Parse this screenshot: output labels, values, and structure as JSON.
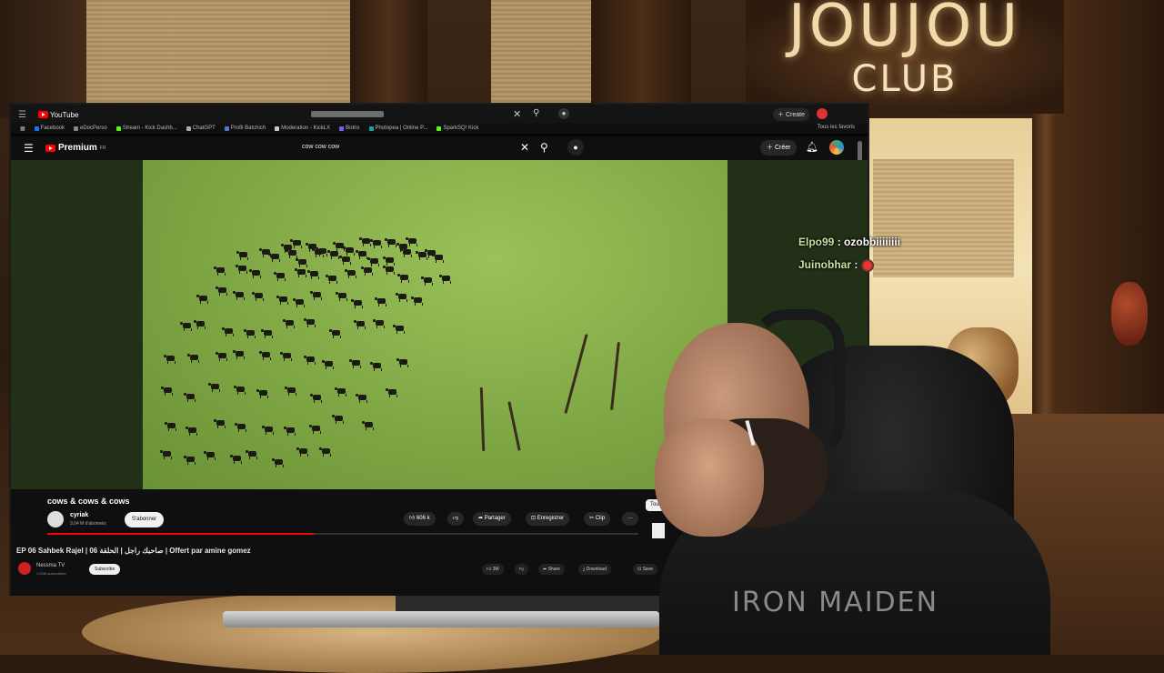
{
  "sign": {
    "title": "JOUJOU",
    "subtitle": "CLUB"
  },
  "browser": {
    "logo_text": "YouTube",
    "create_label": "Create",
    "bookmarks": [
      {
        "label": "Facebook",
        "color": "#1877f2"
      },
      {
        "label": "eDocPerso",
        "color": "#888888"
      },
      {
        "label": "Stream - Kick Dashb...",
        "color": "#53fc18"
      },
      {
        "label": "ChatGPT",
        "color": "#aaaaaa"
      },
      {
        "label": "Profil Batchich",
        "color": "#4a7bd1"
      },
      {
        "label": "Moderation - KickLX",
        "color": "#cccccc"
      },
      {
        "label": "Botrix",
        "color": "#7a5af8"
      },
      {
        "label": "Photopea | Online P...",
        "color": "#18a497"
      },
      {
        "label": "SparkSQ! Kick",
        "color": "#53fc18"
      }
    ],
    "bookmarks_right": "Tous les favoris"
  },
  "youtube": {
    "logo_text": "Premium",
    "logo_sup": "FR",
    "search_value": "cow cow cow",
    "create_label": "Créer"
  },
  "video": {
    "title": "cows & cows & cows",
    "channel": "cyriak",
    "subscribers": "3,04 M d'abonnés",
    "subscribe_label": "S'abonner",
    "likes": "606 k",
    "share_label": "Partager",
    "save_label": "Enregistrer",
    "clip_label": "Clip",
    "more_label": "···",
    "filter_label": "Tout",
    "progress": 0.45
  },
  "overlay_video": {
    "title": "EP 06 Sahbek Rajel | صاحبك راجل | الحلقة 06 | Offert par amine gomez",
    "channel": "Nessma TV",
    "subscribers": "1,93M subscribers",
    "subscribe_label": "Subscribe",
    "likes": "3M",
    "share_label": "Share",
    "download_label": "Download",
    "save_label": "Save"
  },
  "chat": [
    {
      "user": "Elpo99",
      "message": "ozobbiiiiiiii"
    },
    {
      "user": "Juinobhar",
      "message": ""
    }
  ],
  "streamer": {
    "shirt_text": "IRON MAIDEN"
  }
}
